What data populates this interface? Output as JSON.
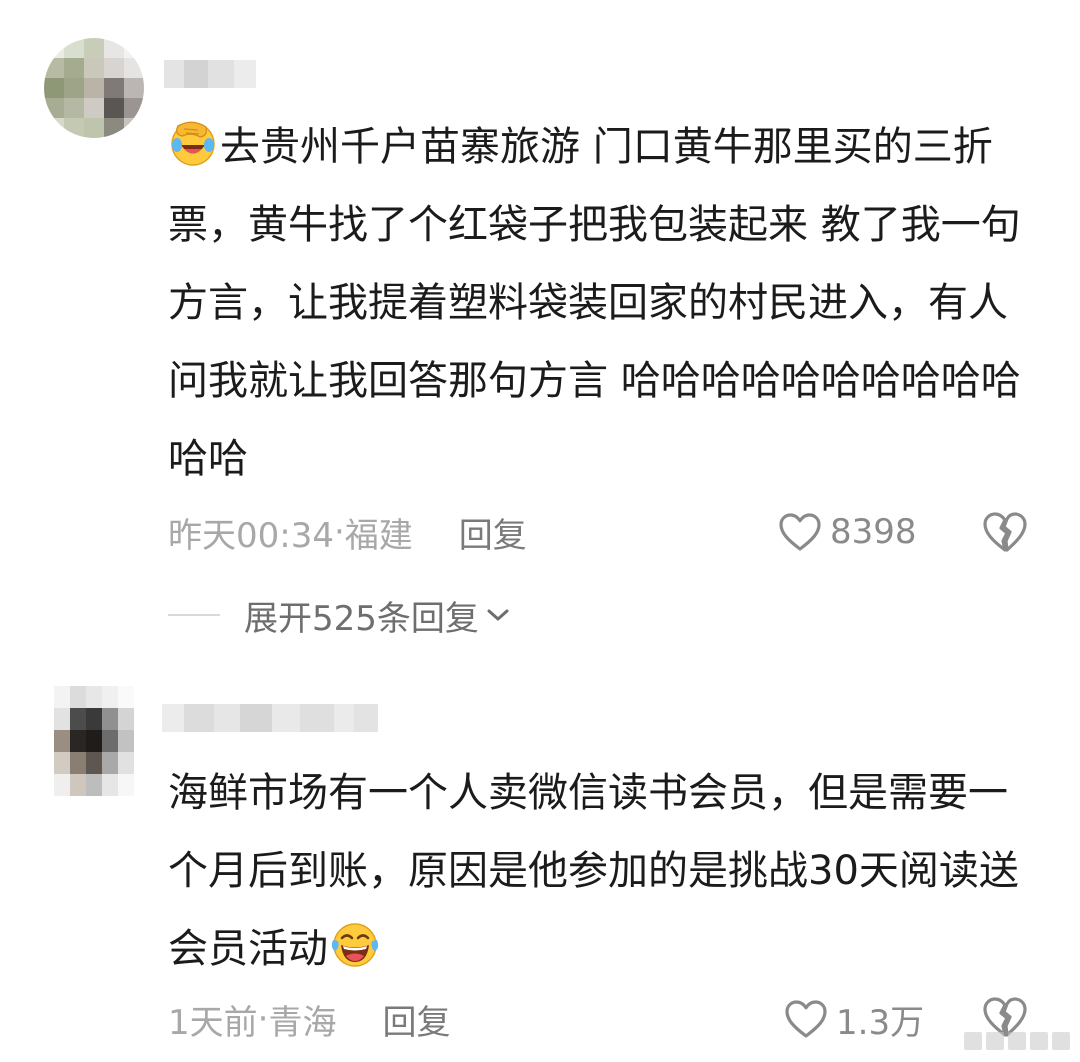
{
  "comments": [
    {
      "text": "去贵州千户苗寨旅游 门口黄牛那里买的三折票，黄牛找了个红袋子把我包装起来  教了我一句方言，让我提着塑料袋装回家的村民进入，有人问我就让我回答那句方言 哈哈哈哈哈哈哈哈哈哈哈哈",
      "emoji": "face-palm-laughing-emoji",
      "time": "昨天00:34",
      "separator": " · ",
      "location": "福建",
      "reply_label": "回复",
      "likes": "8398",
      "expand_label": "展开525条回复"
    },
    {
      "text": "海鲜市场有一个人卖微信读书会员，但是需要一个月后到账，原因是他参加的是挑战30天阅读送会员活动",
      "emoji": "tears-of-joy-emoji",
      "time": "1天前",
      "separator": " · ",
      "location": "青海",
      "reply_label": "回复",
      "likes": "1.3万"
    }
  ],
  "colors": {
    "background": "#ffffff",
    "text": "#1b1b1b",
    "meta": "#9c9c9c",
    "icon": "#8a8a8a"
  },
  "icons": [
    "heart-outline-icon",
    "broken-heart-icon",
    "chevron-down-icon"
  ]
}
